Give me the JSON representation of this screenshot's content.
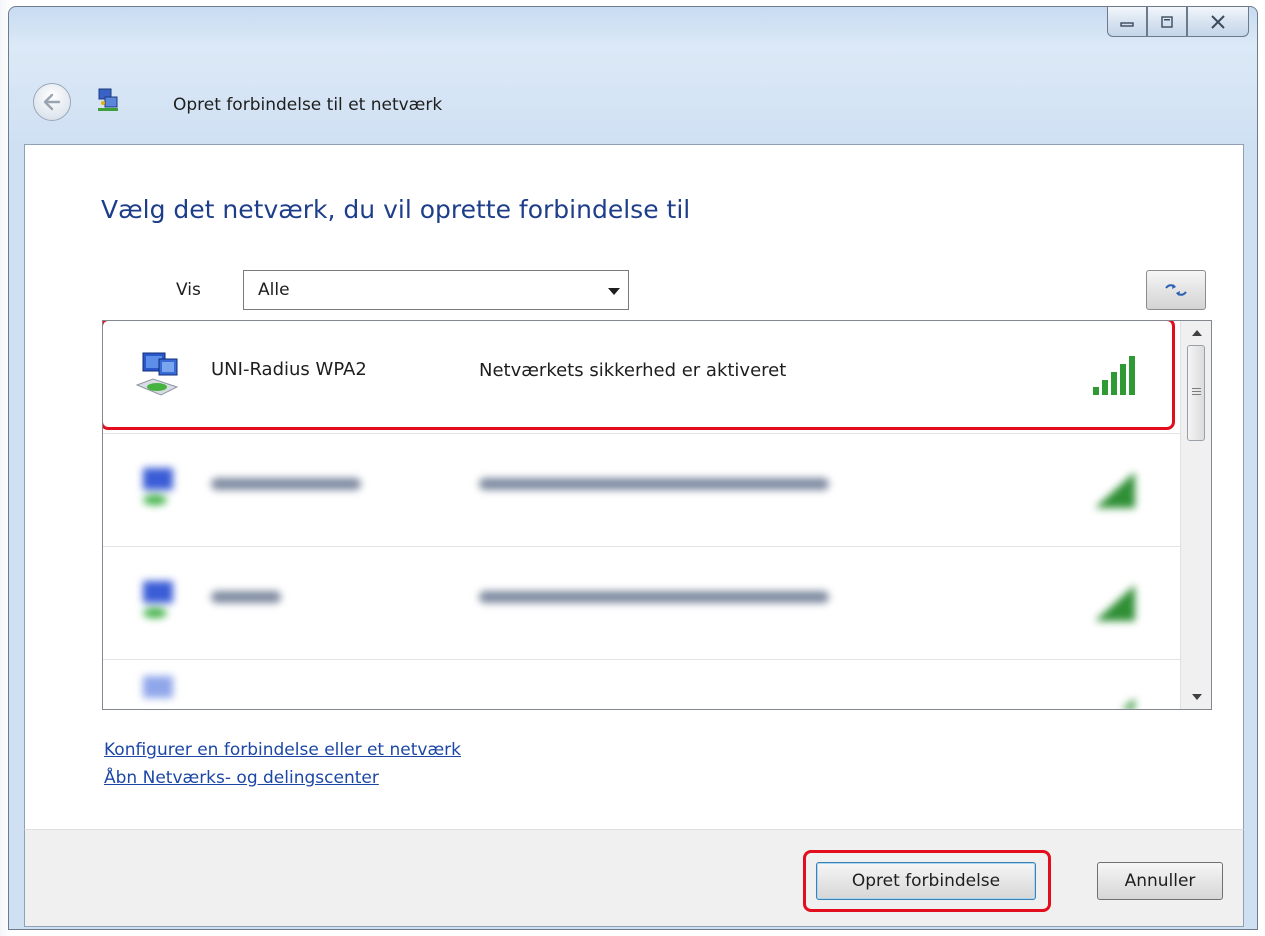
{
  "window": {
    "title_bar_buttons": [
      "minimize-icon",
      "maximize-icon",
      "close-icon"
    ]
  },
  "header": {
    "title": "Opret forbindelse til et netværk"
  },
  "main": {
    "heading": "Vælg det netværk, du vil oprette forbindelse til",
    "filter": {
      "label": "Vis",
      "selected": "Alle"
    }
  },
  "networks": [
    {
      "name": "UNI-Radius WPA2",
      "status": "Netværkets sikkerhed er aktiveret",
      "signal_bars": 5,
      "highlighted": true
    },
    {
      "name": "",
      "status": "",
      "signal_bars": 5,
      "blurred": true
    },
    {
      "name": "",
      "status": "",
      "signal_bars": 5,
      "blurred": true
    },
    {
      "name": "",
      "status": "",
      "signal_bars": 5,
      "blurred": true
    }
  ],
  "links": {
    "configure": "Konfigurer en forbindelse eller et netværk",
    "network_center": "Åbn Netværks- og delingscenter"
  },
  "footer": {
    "connect_label": "Opret forbindelse",
    "cancel_label": "Annuller"
  },
  "colors": {
    "heading_blue": "#1e3e8a",
    "link_blue": "#1c47a6",
    "highlight_red": "#e20e1e",
    "signal_green": "#2f9a34"
  }
}
